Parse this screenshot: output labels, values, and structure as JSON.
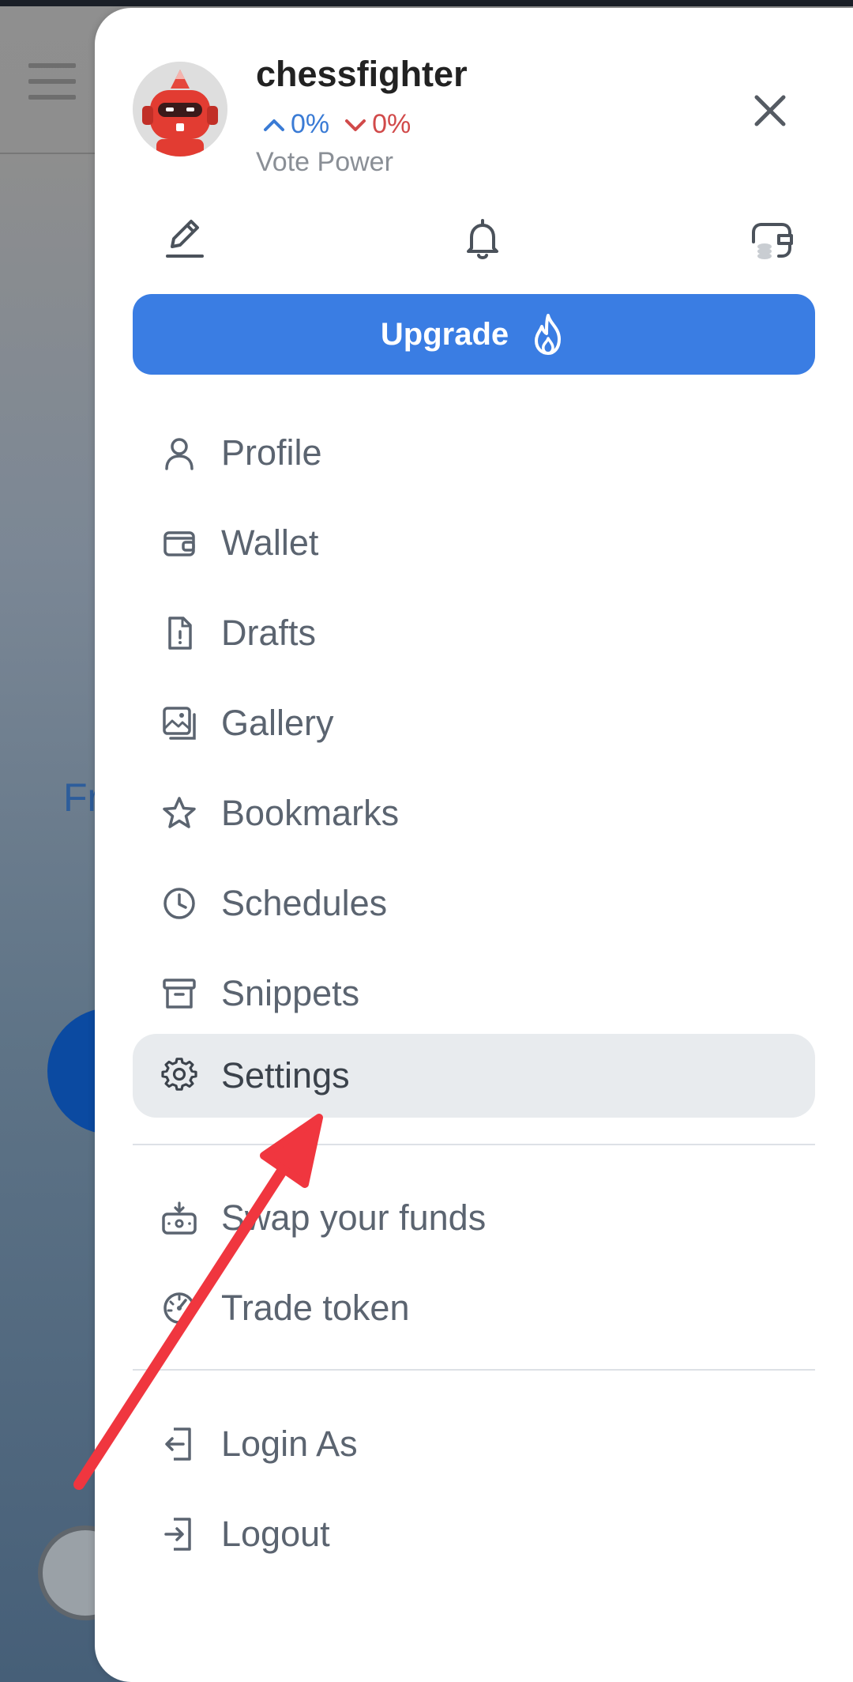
{
  "user": {
    "name": "chessfighter",
    "vote_up": "0%",
    "vote_down": "0%",
    "vote_label": "Vote Power"
  },
  "upgrade_label": "Upgrade",
  "menu": {
    "items": [
      {
        "label": "Profile",
        "icon": "user-icon"
      },
      {
        "label": "Wallet",
        "icon": "wallet-icon"
      },
      {
        "label": "Drafts",
        "icon": "document-icon"
      },
      {
        "label": "Gallery",
        "icon": "gallery-icon"
      },
      {
        "label": "Bookmarks",
        "icon": "star-icon"
      },
      {
        "label": "Schedules",
        "icon": "clock-icon"
      },
      {
        "label": "Snippets",
        "icon": "archive-icon"
      },
      {
        "label": "Settings",
        "icon": "gear-icon",
        "active": true
      }
    ],
    "extra": [
      {
        "label": "Swap your funds",
        "icon": "swap-icon"
      },
      {
        "label": "Trade token",
        "icon": "trade-icon"
      }
    ],
    "account": [
      {
        "label": "Login As",
        "icon": "login-icon"
      },
      {
        "label": "Logout",
        "icon": "logout-icon"
      }
    ]
  },
  "background": {
    "partial_text": "Fr"
  },
  "colors": {
    "accent": "#3a7de3",
    "vote_up": "#3a7bd5",
    "vote_down": "#d14a4a",
    "annotation_arrow": "#f0363f",
    "active_row": "#e8ebee"
  }
}
